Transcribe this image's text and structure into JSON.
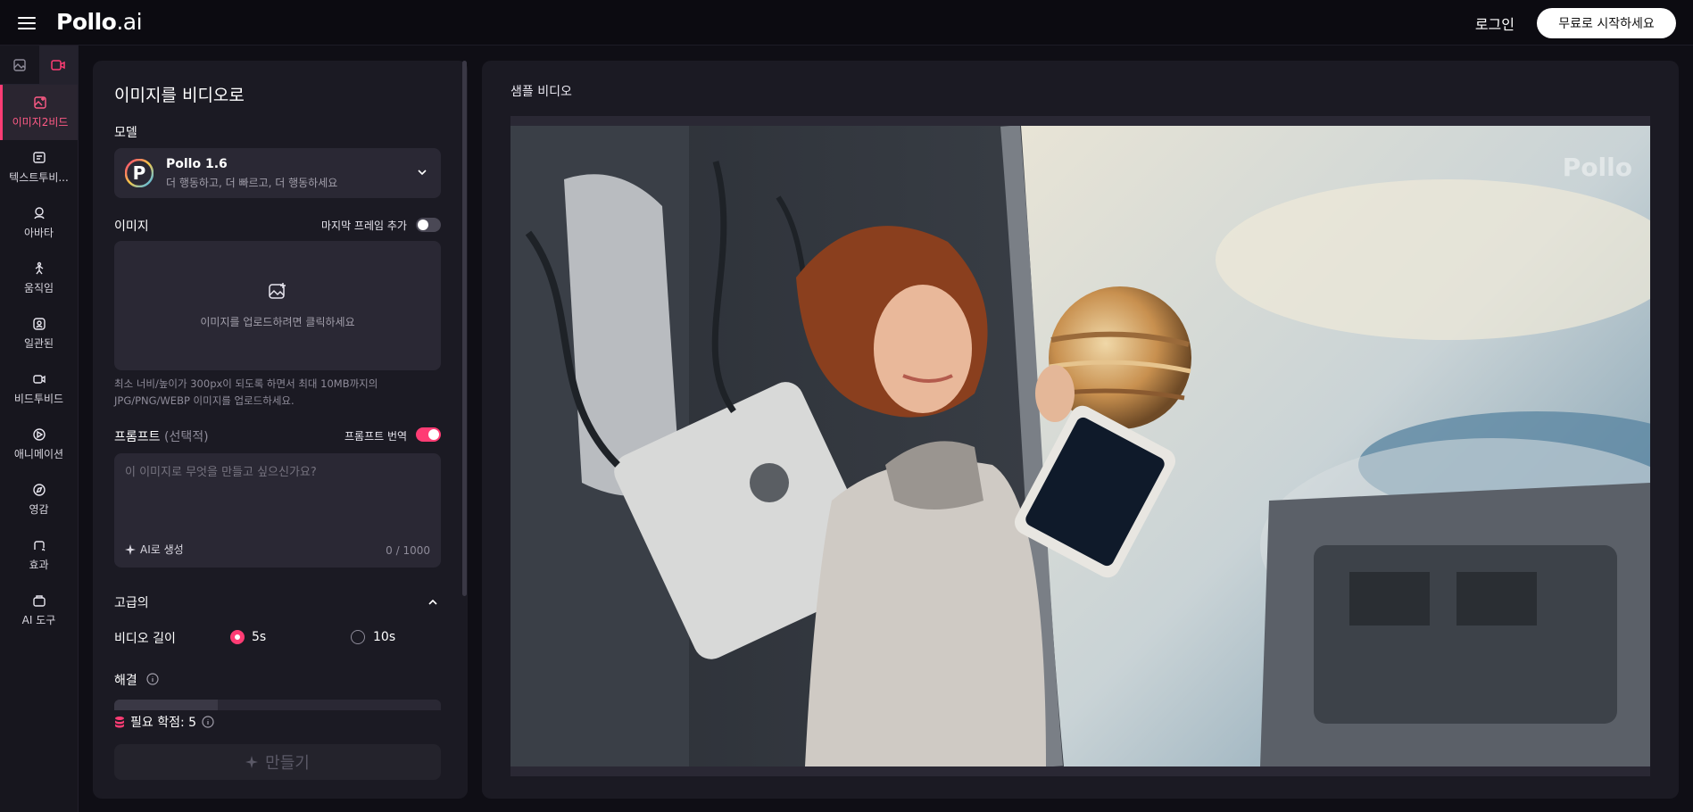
{
  "header": {
    "logo_main": "Pollo",
    "logo_suffix": ".ai",
    "login_label": "로그인",
    "start_label": "무료로 시작하세요"
  },
  "sidebar": {
    "tabs": [
      {
        "icon": "image-icon",
        "active": false
      },
      {
        "icon": "video-icon",
        "active": true
      }
    ],
    "items": [
      {
        "label": "이미지2비드",
        "icon": "image-to-video-icon",
        "active": true
      },
      {
        "label": "텍스트투비...",
        "icon": "text-to-video-icon",
        "active": false
      },
      {
        "label": "아바타",
        "icon": "avatar-icon",
        "active": false
      },
      {
        "label": "움직임",
        "icon": "motion-icon",
        "active": false
      },
      {
        "label": "일관된",
        "icon": "consistent-icon",
        "active": false
      },
      {
        "label": "비드투비드",
        "icon": "video-to-video-icon",
        "active": false
      },
      {
        "label": "애니메이션",
        "icon": "animation-icon",
        "active": false
      },
      {
        "label": "영감",
        "icon": "compass-icon",
        "active": false
      },
      {
        "label": "효과",
        "icon": "effects-icon",
        "active": false
      },
      {
        "label": "AI 도구",
        "icon": "ai-tools-icon",
        "active": false
      }
    ]
  },
  "form": {
    "title": "이미지를 비디오로",
    "model_label": "모델",
    "model_name": "Pollo 1.6",
    "model_desc": "더 행동하고, 더 빠르고, 더 행동하세요",
    "image_label": "이미지",
    "last_frame_label": "마지막 프레임 추가",
    "last_frame_enabled": false,
    "upload_text": "이미지를 업로드하려면 클릭하세요",
    "upload_hint": "최소 너비/높이가 300px이 되도록 하면서 최대 10MB까지의 JPG/PNG/WEBP 이미지를 업로드하세요.",
    "prompt_label": "프롬프트",
    "prompt_optional": "(선택적)",
    "translate_label": "프롬프트 번역",
    "translate_enabled": true,
    "prompt_value": "",
    "prompt_placeholder": "이 이미지로 무엇을 만들고 싶으신가요?",
    "ai_generate_label": "AI로 생성",
    "char_counter": "0 / 1000",
    "advanced_label": "고급의",
    "duration_label": "비디오 길이",
    "duration_options": [
      "5s",
      "10s"
    ],
    "duration_selected": "5s",
    "resolution_label": "해결",
    "credits_label": "필요 학점: 5",
    "create_label": "만들기"
  },
  "preview": {
    "label": "샘플 비디오",
    "watermark": "Pollo"
  },
  "colors": {
    "accent": "#ff3c74",
    "panel": "#1b1a23",
    "field": "#2a2834",
    "background": "#0f0e15"
  }
}
